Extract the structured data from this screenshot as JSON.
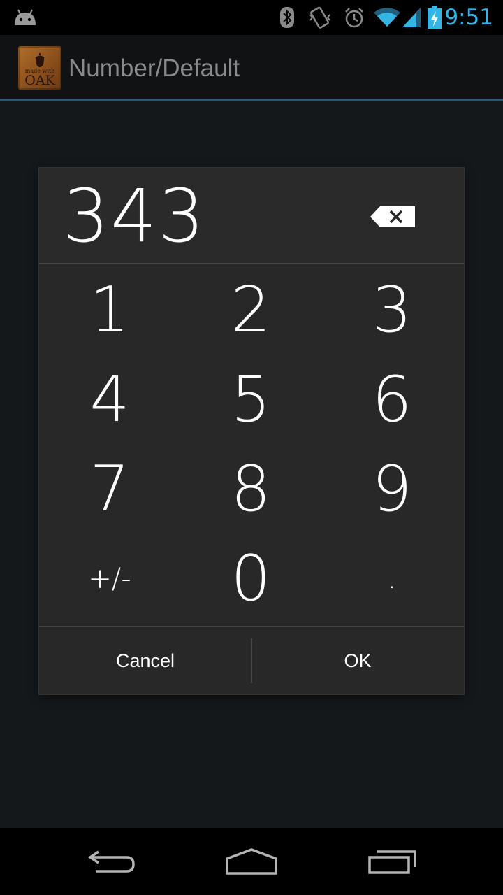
{
  "status_bar": {
    "time": "9:51",
    "icons": [
      "android-icon",
      "bluetooth-icon",
      "vibrate-icon",
      "alarm-icon",
      "wifi-icon",
      "signal-icon",
      "battery-charging-icon"
    ],
    "accent_color": "#33b5e5"
  },
  "action_bar": {
    "title": "Number/Default",
    "app_icon_text": [
      "made with",
      "OAK"
    ],
    "accent_color": "#28587a"
  },
  "dialog": {
    "display_value": "343",
    "backspace_icon": "backspace-icon",
    "keys": [
      "1",
      "2",
      "3",
      "4",
      "5",
      "6",
      "7",
      "8",
      "9",
      "+/-",
      "0",
      "."
    ],
    "cancel_label": "Cancel",
    "ok_label": "OK"
  },
  "nav_bar": {
    "icons": [
      "back-icon",
      "home-icon",
      "recents-icon"
    ]
  }
}
